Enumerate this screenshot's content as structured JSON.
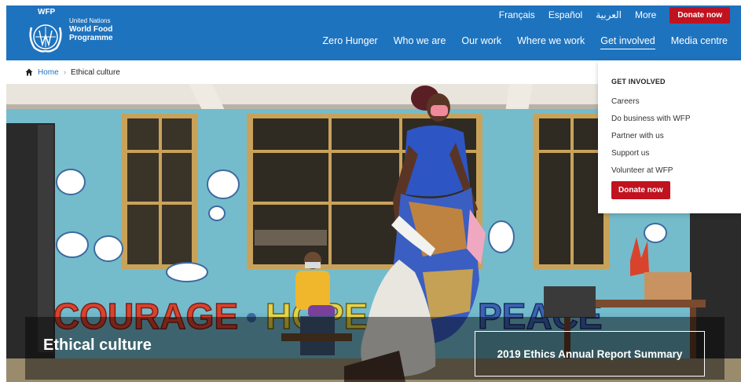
{
  "logo": {
    "abbr": "WFP",
    "line1": "United Nations",
    "line2": "World Food",
    "line3": "Programme"
  },
  "utility_nav": {
    "french": "Français",
    "spanish": "Español",
    "arabic": "العربية",
    "more": "More",
    "donate": "Donate now"
  },
  "main_nav": [
    {
      "label": "Zero Hunger"
    },
    {
      "label": "Who we are"
    },
    {
      "label": "Our work"
    },
    {
      "label": "Where we work"
    },
    {
      "label": "Get involved"
    },
    {
      "label": "Media centre"
    }
  ],
  "breadcrumb": {
    "home": "Home",
    "separator": "›",
    "current": "Ethical culture"
  },
  "hero": {
    "title": "Ethical culture",
    "report_button": "2019 Ethics Annual Report Summary"
  },
  "dropdown": {
    "heading": "GET INVOLVED",
    "items": [
      {
        "label": "Careers"
      },
      {
        "label": "Do business with WFP"
      },
      {
        "label": "Partner with us"
      },
      {
        "label": "Support us"
      },
      {
        "label": "Volunteer at WFP"
      }
    ],
    "donate": "Donate now"
  },
  "colors": {
    "brand_blue": "#1e73be",
    "donate_red": "#c1121f"
  }
}
